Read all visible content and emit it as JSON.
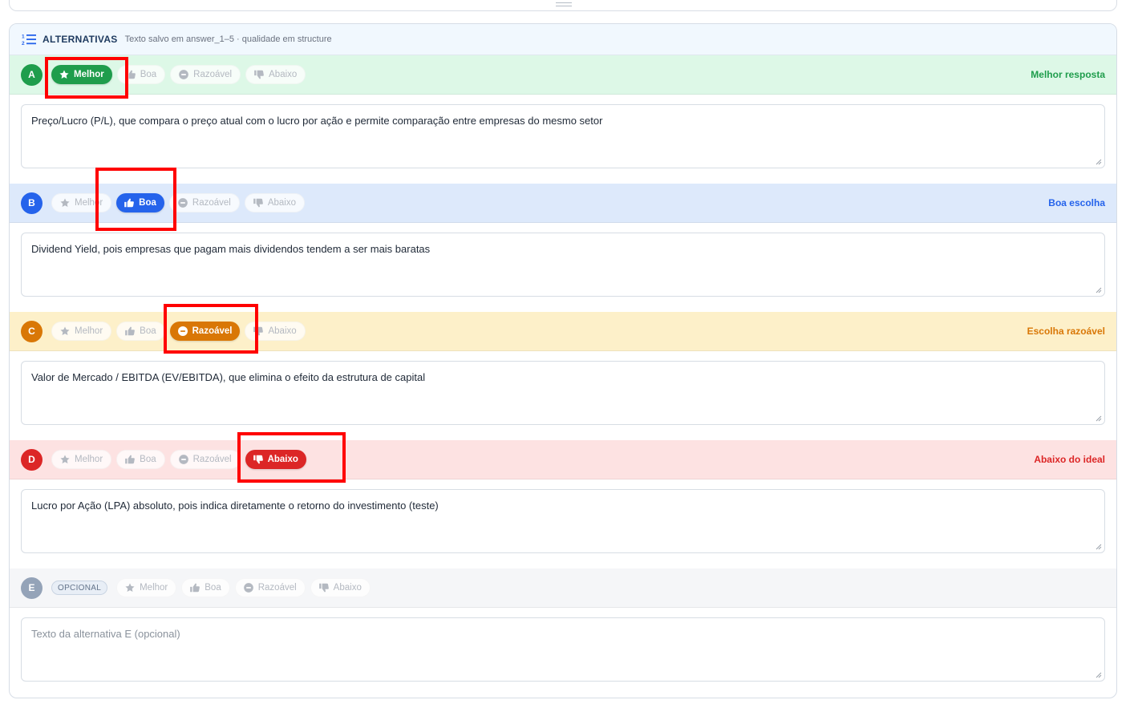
{
  "header": {
    "title": "ALTERNATIVAS",
    "subtitle": "Texto salvo em answer_1–5 · qualidade em structure"
  },
  "ratings": {
    "best": "Melhor",
    "good": "Boa",
    "fair": "Razoável",
    "below": "Abaixo"
  },
  "alternatives": [
    {
      "letter": "A",
      "selected": "Melhor",
      "status": "Melhor resposta",
      "text": "Preço/Lucro (P/L), que compara o preço atual com o lucro por ação e permite comparação entre empresas do mesmo setor"
    },
    {
      "letter": "B",
      "selected": "Boa",
      "status": "Boa escolha",
      "text": "Dividend Yield, pois empresas que pagam mais dividendos tendem a ser mais baratas"
    },
    {
      "letter": "C",
      "selected": "Razoável",
      "status": "Escolha razoável",
      "text": "Valor de Mercado / EBITDA (EV/EBITDA), que elimina o efeito da estrutura de capital"
    },
    {
      "letter": "D",
      "selected": "Abaixo",
      "status": "Abaixo do ideal",
      "text": "Lucro por Ação (LPA) absoluto, pois indica diretamente o retorno do investimento (teste)"
    },
    {
      "letter": "E",
      "badge": "OPCIONAL",
      "placeholder": "Texto da alternativa E (opcional)"
    }
  ],
  "colors": {
    "best": "#1f9d4c",
    "good": "#2563eb",
    "fair": "#d97706",
    "below": "#dc2626",
    "optional": "#94a3b8",
    "highlight": "#ff0000"
  }
}
